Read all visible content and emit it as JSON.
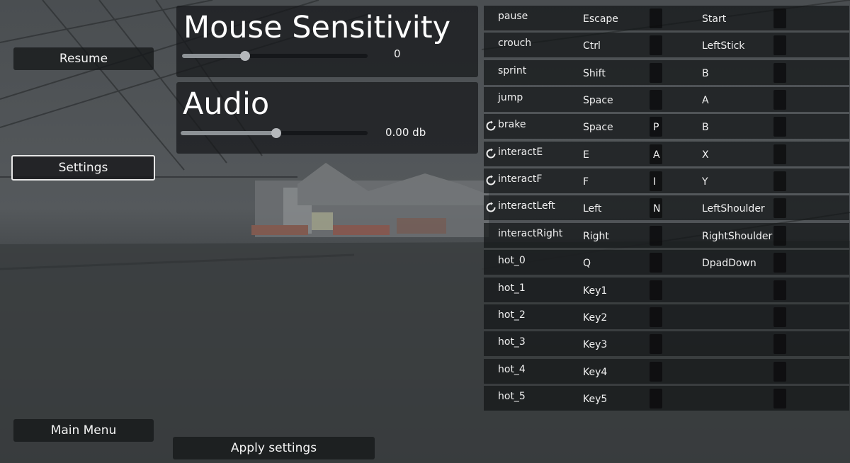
{
  "menu": {
    "resume_label": "Resume",
    "settings_label": "Settings",
    "main_menu_label": "Main Menu",
    "apply_label": "Apply settings"
  },
  "mouse": {
    "title": "Mouse Sensitivity",
    "value_text": "0",
    "level": 0.34
  },
  "audio": {
    "title": "Audio",
    "value_text": "0.00 db",
    "level": 0.51
  },
  "bindings": [
    {
      "action": "pause",
      "key": "Escape",
      "alt_key": "",
      "pad": "Start",
      "icon": false
    },
    {
      "action": "crouch",
      "key": "Ctrl",
      "alt_key": "",
      "pad": "LeftStick",
      "icon": false
    },
    {
      "action": "sprint",
      "key": "Shift",
      "alt_key": "",
      "pad": "B",
      "icon": false
    },
    {
      "action": "jump",
      "key": "Space",
      "alt_key": "",
      "pad": "A",
      "icon": false
    },
    {
      "action": "brake",
      "key": "Space",
      "alt_key": "P",
      "pad": "B",
      "icon": true
    },
    {
      "action": "interactE",
      "key": "E",
      "alt_key": "A",
      "pad": "X",
      "icon": true
    },
    {
      "action": "interactF",
      "key": "F",
      "alt_key": "I",
      "pad": "Y",
      "icon": true
    },
    {
      "action": "interactLeft",
      "key": "Left",
      "alt_key": "N",
      "pad": "LeftShoulder",
      "icon": true
    },
    {
      "action": "interactRight",
      "key": "Right",
      "alt_key": "",
      "pad": "RightShoulder",
      "icon": false
    },
    {
      "action": "hot_0",
      "key": "Q",
      "alt_key": "",
      "pad": "DpadDown",
      "icon": false
    },
    {
      "action": "hot_1",
      "key": "Key1",
      "alt_key": "",
      "pad": "",
      "icon": false
    },
    {
      "action": "hot_2",
      "key": "Key2",
      "alt_key": "",
      "pad": "",
      "icon": false
    },
    {
      "action": "hot_3",
      "key": "Key3",
      "alt_key": "",
      "pad": "",
      "icon": false
    },
    {
      "action": "hot_4",
      "key": "Key4",
      "alt_key": "",
      "pad": "",
      "icon": false
    },
    {
      "action": "hot_5",
      "key": "Key5",
      "alt_key": "",
      "pad": "",
      "icon": false
    }
  ],
  "colors": {
    "panel_bg": "#16181a",
    "text": "#f2f2f2",
    "slider_fill": "#8d9296"
  }
}
